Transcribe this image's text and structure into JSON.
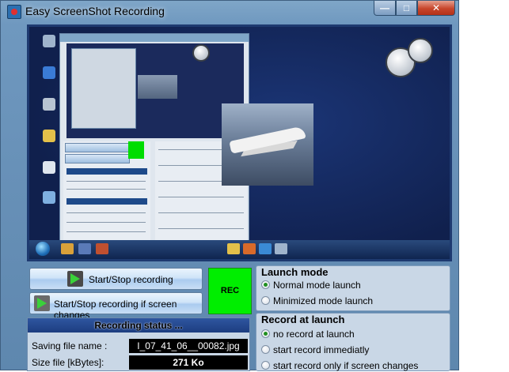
{
  "window": {
    "title": "Easy ScreenShot Recording",
    "controls": {
      "minimize": "—",
      "maximize": "□",
      "close": "✕"
    }
  },
  "buttons": {
    "start_stop": "Start/Stop recording",
    "start_stop_if_changes": "Start/Stop recording if screen changes"
  },
  "rec_indicator": "REC",
  "recording_status": {
    "header": "Recording status ...",
    "saving_file_label": "Saving file name :",
    "saving_file_value": "I_07_41_06__00082.jpg",
    "size_label": "Size file [kBytes]:",
    "size_value": "271 Ko"
  },
  "launch_mode": {
    "title": "Launch mode",
    "options": [
      "Normal mode launch",
      "Minimized mode launch"
    ],
    "selected": "Normal mode launch"
  },
  "record_at_launch": {
    "title": "Record at launch",
    "options": [
      "no record at launch",
      "start record immediatly",
      "start record only if screen changes"
    ],
    "selected": "no record at launch"
  },
  "colors": {
    "rec_green": "#00ee00",
    "status_header": "#1c3d80",
    "window_frame": "#6f98bf"
  }
}
